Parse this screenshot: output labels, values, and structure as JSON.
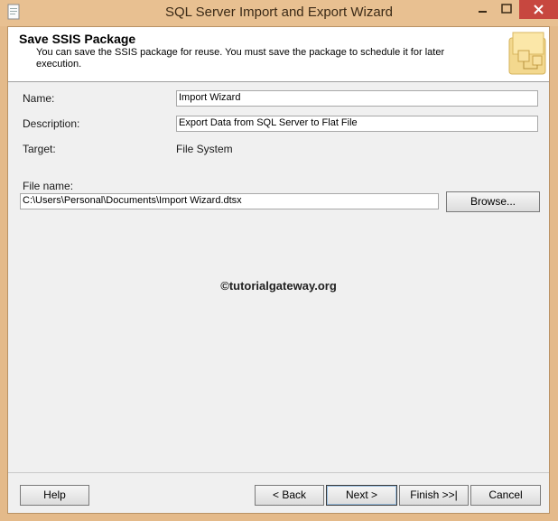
{
  "window": {
    "title": "SQL Server Import and Export Wizard"
  },
  "header": {
    "title": "Save SSIS Package",
    "description": "You can save the SSIS package for reuse. You must save the package to schedule it for later execution."
  },
  "form": {
    "name_label": "Name:",
    "name_value": "Import Wizard",
    "description_label": "Description:",
    "description_value": "Export Data from SQL Server to Flat File",
    "target_label": "Target:",
    "target_value": "File System",
    "file_name_label": "File name:",
    "file_name_value": "C:\\Users\\Personal\\Documents\\Import Wizard.dtsx",
    "browse_label": "Browse..."
  },
  "watermark": "©tutorialgateway.org",
  "buttons": {
    "help": "Help",
    "back": "< Back",
    "next": "Next >",
    "finish": "Finish >>|",
    "cancel": "Cancel"
  },
  "icons": {
    "app": "document-icon",
    "header_art": "package-folder-icon"
  }
}
